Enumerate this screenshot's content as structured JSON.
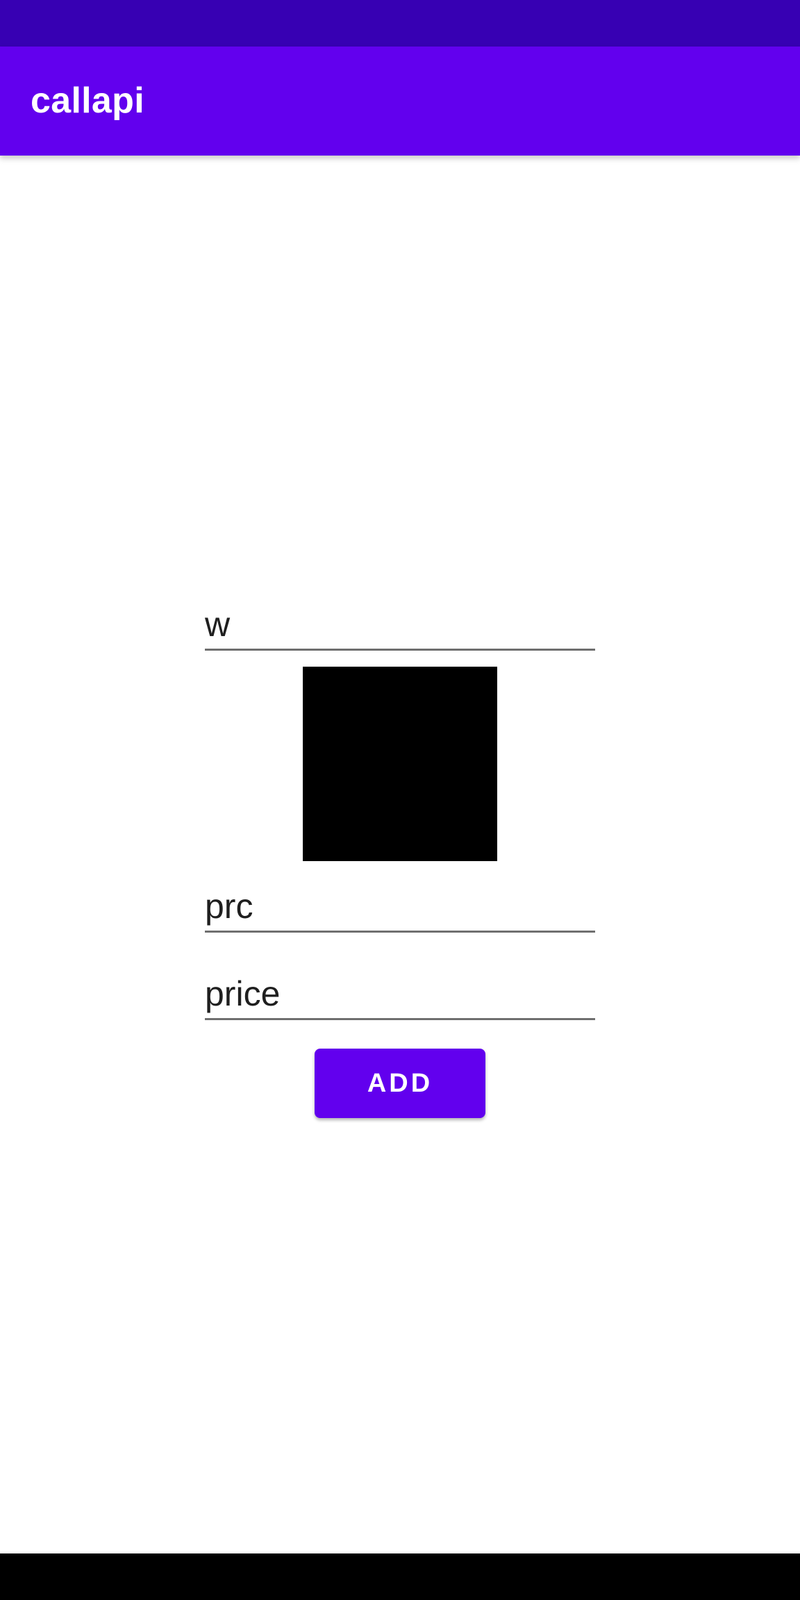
{
  "app": {
    "title": "callapi"
  },
  "form": {
    "field_1_value": "w",
    "field_2_value": "prc",
    "field_3_value": "price",
    "add_button_label": "ADD"
  },
  "colors": {
    "status_bar": "#3700b3",
    "app_bar": "#6200ee",
    "button": "#6200ee",
    "image_placeholder": "#000000",
    "nav_bar": "#000000"
  }
}
